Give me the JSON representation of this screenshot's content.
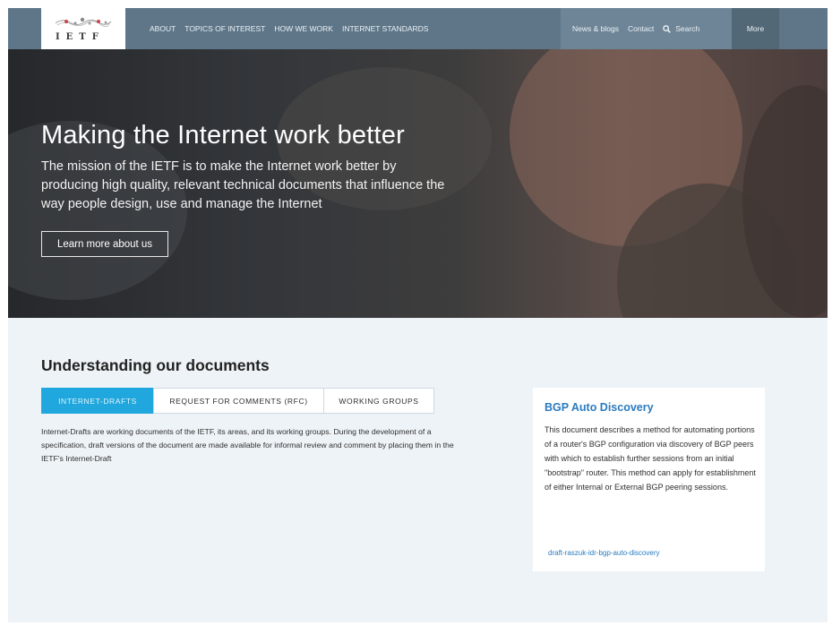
{
  "logo": {
    "text": "IETF"
  },
  "nav": {
    "links": [
      "ABOUT",
      "TOPICS OF INTEREST",
      "HOW WE WORK",
      "INTERNET STANDARDS"
    ],
    "right_links": [
      "News & blogs",
      "Contact"
    ],
    "search_label": "Search",
    "more_label": "More"
  },
  "hero": {
    "title": "Making the Internet work better",
    "subtitle": "The mission of the IETF is to make the Internet work better by producing high quality, relevant technical documents that influence the way people design, use and manage the Internet",
    "button_label": "Learn more about us"
  },
  "documents": {
    "title": "Understanding our documents",
    "tabs": [
      "INTERNET-DRAFTS",
      "REQUEST FOR COMMENTS (RFC)",
      "WORKING GROUPS"
    ],
    "active_tab": "INTERNET-DRAFTS",
    "body": "Internet-Drafts are working documents of the IETF, its areas, and its working groups. During the development of a specification, draft versions of the document are made available for informal review and comment by placing them in the IETF's Internet-Draft"
  },
  "card": {
    "title": "BGP Auto Discovery",
    "body": "This document describes a method for automating portions of a router's BGP configuration via discovery of BGP peers with which to establish further sessions from an initial \"bootstrap\" router. This method can apply for establishment of either Internal or External BGP peering sessions.",
    "link": "draft-raszuk-idr-bgp-auto-discovery"
  },
  "colors": {
    "nav": "#5f7688",
    "accent": "#20a7dd",
    "link": "#2a7bbf",
    "section_bg": "#eef3f7"
  }
}
